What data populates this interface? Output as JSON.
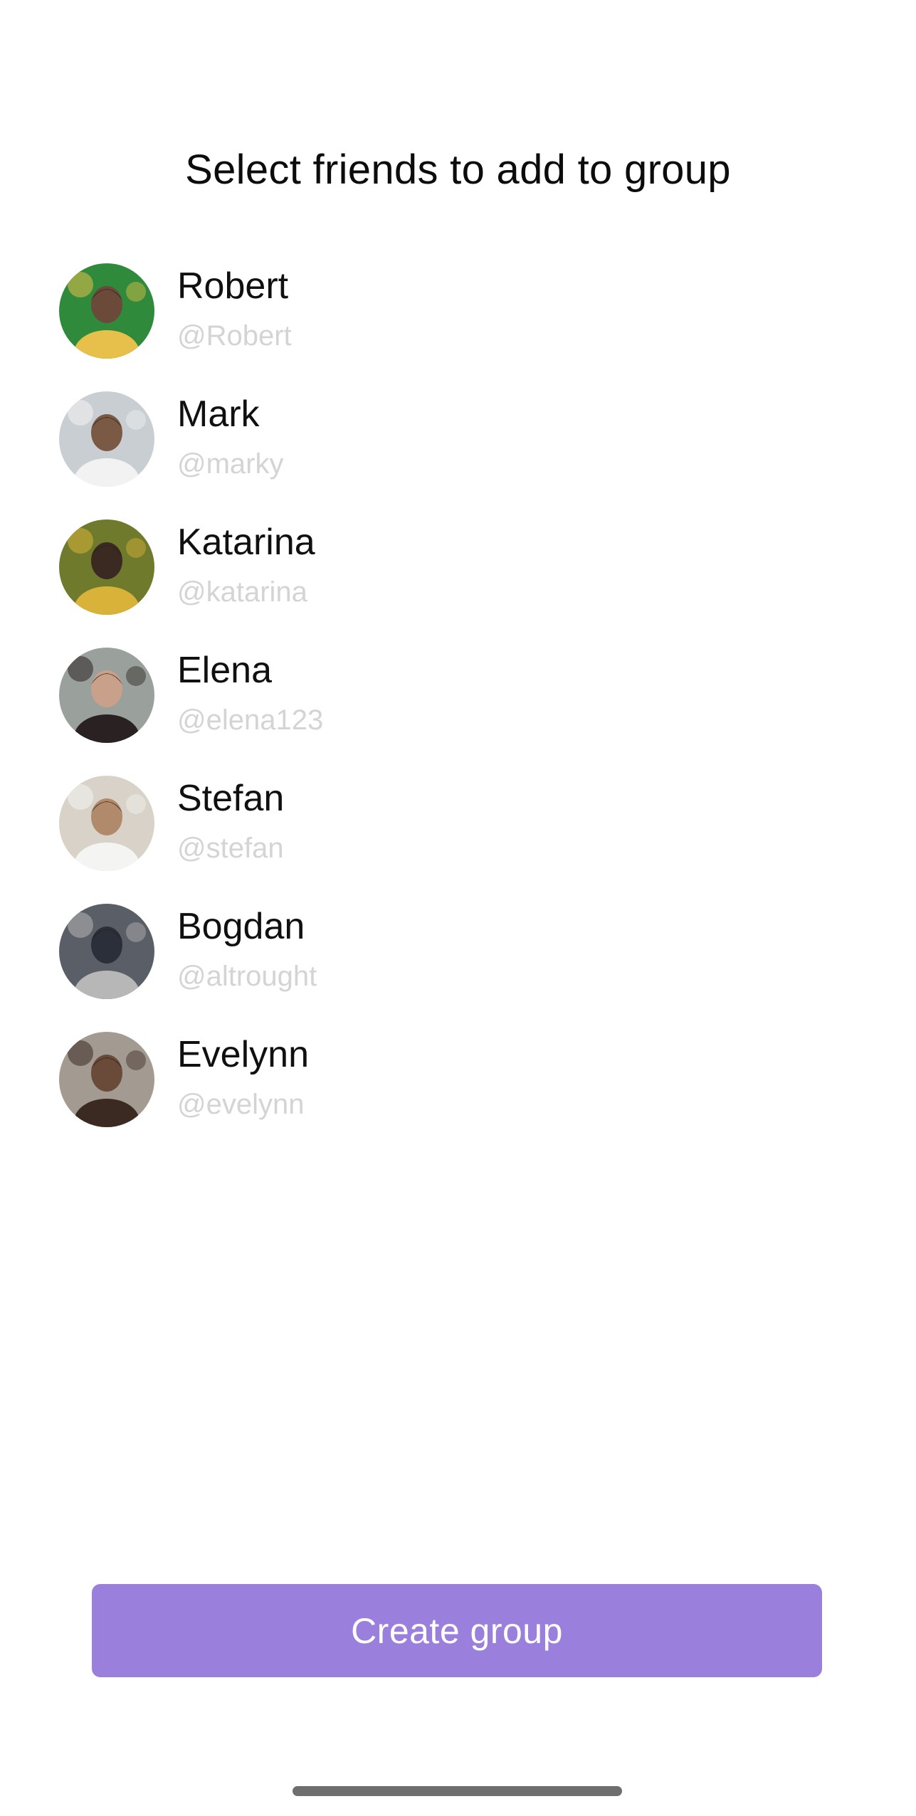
{
  "header": {
    "title": "Select friends to add to group"
  },
  "friends": [
    {
      "name": "Robert",
      "handle": "@Robert",
      "avatar_icon": "robert-avatar-photo",
      "avatar_colors": [
        "#2f8a3c",
        "#e6c04a",
        "#6b4a3a"
      ]
    },
    {
      "name": "Mark",
      "handle": "@marky",
      "avatar_icon": "mark-avatar-photo",
      "avatar_colors": [
        "#c9ced3",
        "#f2f2f2",
        "#7a5a44"
      ]
    },
    {
      "name": "Katarina",
      "handle": "@katarina",
      "avatar_icon": "katarina-avatar-photo",
      "avatar_colors": [
        "#6f7a2c",
        "#d9b23a",
        "#3a2a22"
      ]
    },
    {
      "name": "Elena",
      "handle": "@elena123",
      "avatar_icon": "elena-avatar-photo",
      "avatar_colors": [
        "#9aa09c",
        "#2a2222",
        "#c9a08a"
      ]
    },
    {
      "name": "Stefan",
      "handle": "@stefan",
      "avatar_icon": "stefan-avatar-photo",
      "avatar_colors": [
        "#d8d2c8",
        "#f4f4f2",
        "#b08a6a"
      ]
    },
    {
      "name": "Bogdan",
      "handle": "@altrought",
      "avatar_icon": "bogdan-avatar-photo",
      "avatar_colors": [
        "#5a5e66",
        "#b7b7b7",
        "#2b2f3a"
      ]
    },
    {
      "name": "Evelynn",
      "handle": "@evelynn",
      "avatar_icon": "evelynn-avatar-photo",
      "avatar_colors": [
        "#a39a92",
        "#3b2a22",
        "#6a4a38"
      ]
    }
  ],
  "actions": {
    "create_label": "Create group"
  },
  "colors": {
    "accent": "#9b7fdc",
    "home_indicator": "#6e6e6e"
  }
}
